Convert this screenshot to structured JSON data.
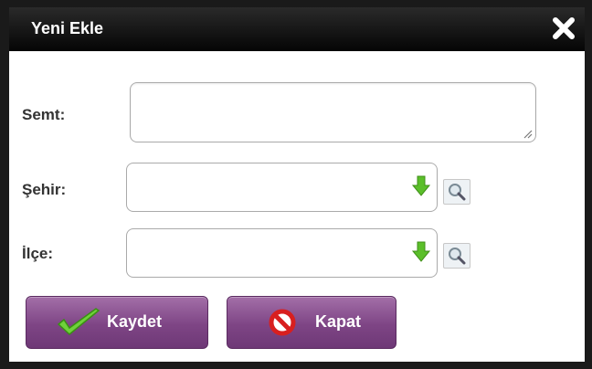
{
  "dialog": {
    "title": "Yeni Ekle",
    "close_icon": "close-icon"
  },
  "form": {
    "semt_label": "Semt:",
    "semt_value": "",
    "sehir_label": "Şehir:",
    "sehir_value": "",
    "ilce_label": "İlçe:",
    "ilce_value": ""
  },
  "buttons": {
    "save_label": "Kaydet",
    "close_label": "Kapat"
  },
  "colors": {
    "button_purple": "#7e4585",
    "title_bar": "#0a0a0a",
    "arrow_green": "#5bbf2a"
  }
}
